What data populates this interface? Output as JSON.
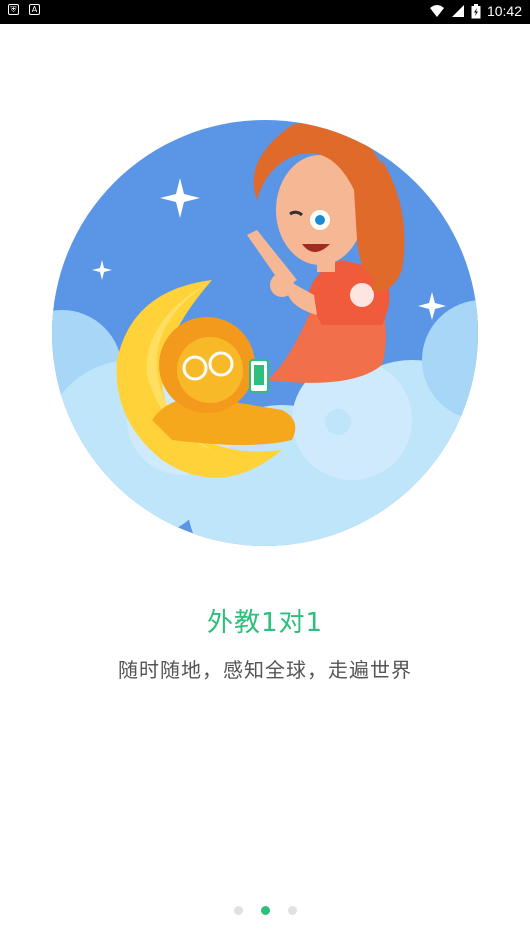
{
  "status_bar": {
    "time": "10:42",
    "left_icons": [
      "shield-icon",
      "a-icon"
    ],
    "right_icons": [
      "wifi-icon",
      "signal-icon",
      "battery-icon"
    ]
  },
  "onboarding": {
    "title": "外教1对1",
    "subtitle": "随时随地，感知全球，走遍世界",
    "page_indicator": {
      "total": 3,
      "active_index": 1
    },
    "colors": {
      "accent": "#2dbf7b",
      "sky": "#5b95e6",
      "cloud": "#bfe5fb",
      "moon": "#ffd23a"
    }
  }
}
